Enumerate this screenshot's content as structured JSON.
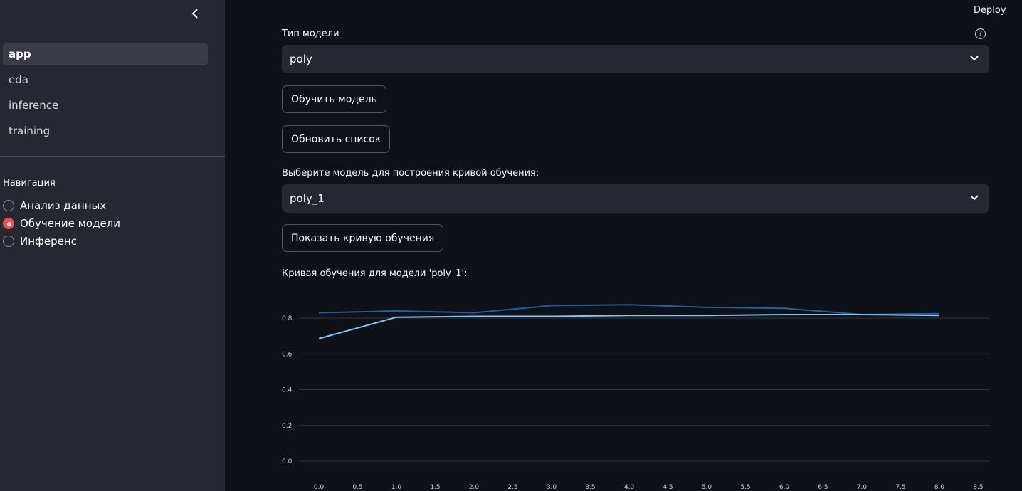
{
  "header": {
    "deploy_label": "Deploy"
  },
  "sidebar": {
    "pages": [
      {
        "label": "app",
        "active": true
      },
      {
        "label": "eda",
        "active": false
      },
      {
        "label": "inference",
        "active": false
      },
      {
        "label": "training",
        "active": false
      }
    ],
    "nav_label": "Навигация",
    "nav_options": [
      {
        "label": "Анализ данных",
        "checked": false
      },
      {
        "label": "Обучение модели",
        "checked": true
      },
      {
        "label": "Инференс",
        "checked": false
      }
    ]
  },
  "main": {
    "model_type_label": "Тип модели",
    "model_type_value": "poly",
    "train_button": "Обучить модель",
    "refresh_button": "Обновить список",
    "model_select_label": "Выберите модель для построения кривой обучения:",
    "model_select_value": "poly_1",
    "show_curve_button": "Показать кривую обучения",
    "chart_caption": "Кривая обучения для модели 'poly_1':"
  },
  "colors": {
    "accent": "#ff4b4b",
    "series_dark": "#1f5fa6",
    "series_light": "#83c2f7"
  },
  "chart_data": {
    "type": "line",
    "x_ticks": [
      "0.0",
      "0.5",
      "1.0",
      "1.5",
      "2.0",
      "2.5",
      "3.0",
      "3.5",
      "4.0",
      "4.5",
      "5.0",
      "5.5",
      "6.0",
      "6.5",
      "7.0",
      "7.5",
      "8.0",
      "8.5"
    ],
    "y_ticks": [
      "0.0",
      "0.2",
      "0.4",
      "0.6",
      "0.8"
    ],
    "xlim": [
      0,
      8.5
    ],
    "ylim": [
      0,
      0.8
    ],
    "series": [
      {
        "x": [
          0,
          1,
          2,
          3,
          4,
          5,
          6,
          7,
          8
        ],
        "y": [
          0.83,
          0.84,
          0.83,
          0.87,
          0.875,
          0.86,
          0.855,
          0.82,
          0.825
        ],
        "color": "#1f5fa6"
      },
      {
        "x": [
          0,
          1,
          2,
          3,
          4,
          5,
          6,
          7,
          8
        ],
        "y": [
          0.685,
          0.805,
          0.81,
          0.81,
          0.815,
          0.815,
          0.82,
          0.82,
          0.815
        ],
        "color": "#83c2f7"
      }
    ]
  }
}
